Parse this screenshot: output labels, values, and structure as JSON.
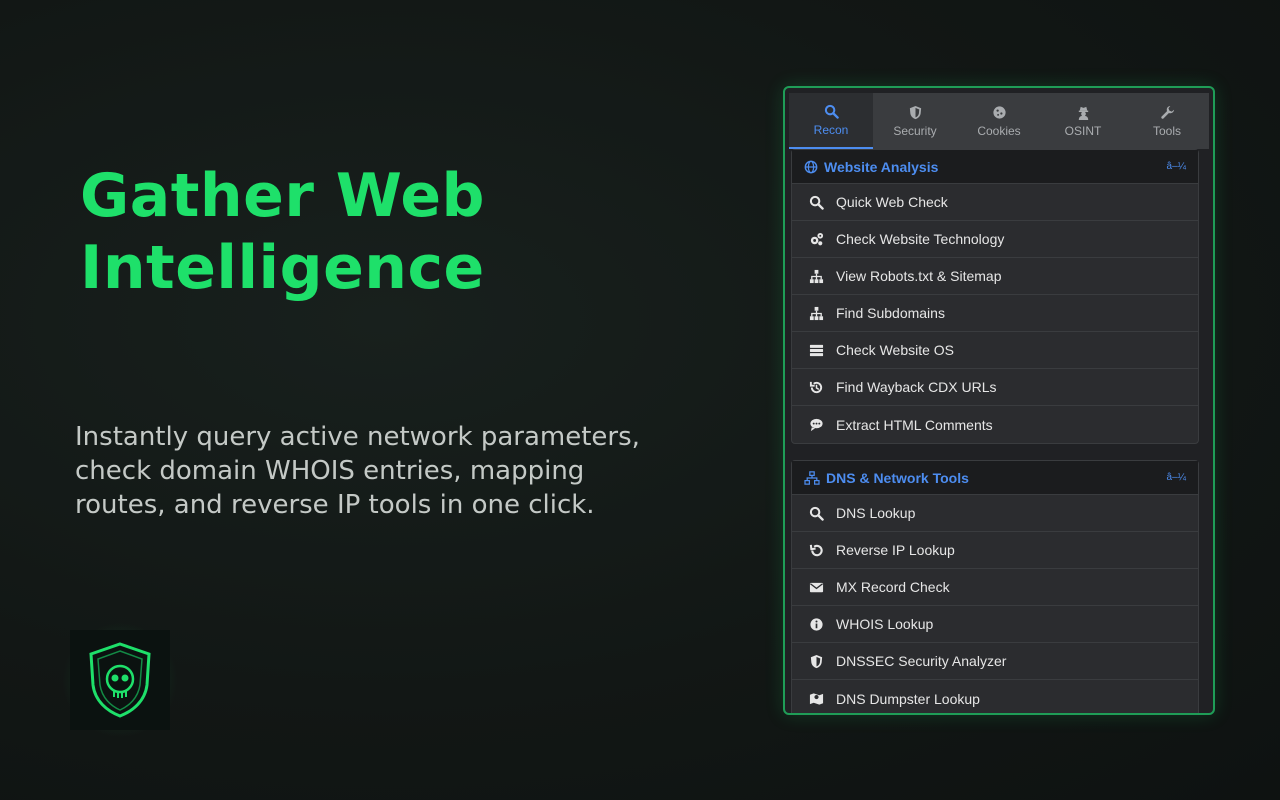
{
  "hero": {
    "headline": "Gather Web Intelligence",
    "description": "Instantly query active network parameters, check domain WHOIS entries, mapping routes, and reverse IP tools in one click."
  },
  "colors": {
    "accent": "#1ee06a",
    "link": "#4d8df0",
    "panel": "#202124"
  },
  "tabs": [
    {
      "label": "Recon",
      "icon": "search-icon",
      "active": true
    },
    {
      "label": "Security",
      "icon": "shield-icon",
      "active": false
    },
    {
      "label": "Cookies",
      "icon": "cookie-icon",
      "active": false
    },
    {
      "label": "OSINT",
      "icon": "user-secret-icon",
      "active": false
    },
    {
      "label": "Tools",
      "icon": "wrench-icon",
      "active": false
    }
  ],
  "sections": [
    {
      "title": "Website Analysis",
      "icon": "globe-icon",
      "toggle": "â–¼",
      "items": [
        {
          "label": "Quick Web Check",
          "icon": "search-icon"
        },
        {
          "label": "Check Website Technology",
          "icon": "gears-icon"
        },
        {
          "label": "View Robots.txt & Sitemap",
          "icon": "sitemap-icon"
        },
        {
          "label": "Find Subdomains",
          "icon": "sitemap-icon"
        },
        {
          "label": "Check Website OS",
          "icon": "server-icon"
        },
        {
          "label": "Find Wayback CDX URLs",
          "icon": "history-icon"
        },
        {
          "label": "Extract HTML Comments",
          "icon": "comment-icon"
        }
      ]
    },
    {
      "title": "DNS & Network Tools",
      "icon": "network-icon",
      "toggle": "â–¼",
      "items": [
        {
          "label": "DNS Lookup",
          "icon": "search-icon"
        },
        {
          "label": "Reverse IP Lookup",
          "icon": "undo-icon"
        },
        {
          "label": "MX Record Check",
          "icon": "envelope-icon"
        },
        {
          "label": "WHOIS Lookup",
          "icon": "info-icon"
        },
        {
          "label": "DNSSEC Security Analyzer",
          "icon": "shield-icon"
        },
        {
          "label": "DNS Dumpster Lookup",
          "icon": "map-icon"
        }
      ]
    }
  ]
}
